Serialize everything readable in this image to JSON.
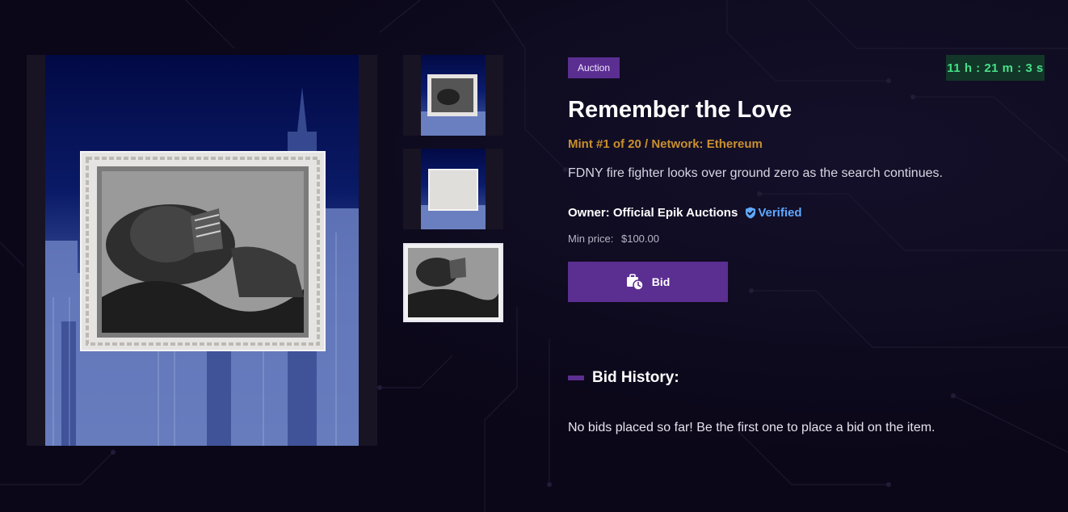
{
  "item": {
    "type_badge": "Auction",
    "countdown": "11 h : 21 m : 3 s",
    "title": "Remember the Love",
    "mint_info": "Mint #1 of 20  / Network: Ethereum",
    "description": "FDNY fire fighter looks over ground zero as the search continues.",
    "owner_label": "Owner: Official Epik Auctions",
    "verified_label": "Verified",
    "min_price_label": "Min price:",
    "min_price_value": "$100.00",
    "bid_button_label": "Bid"
  },
  "history": {
    "heading": "Bid History:",
    "empty_message": "No bids placed so far! Be the first one to place a bid on the item."
  },
  "colors": {
    "accent": "#5b2e91",
    "mint": "#c9902e",
    "timer_text": "#46e08a",
    "verified": "#5fa8ff",
    "background": "#0b0718"
  },
  "icons": {
    "verified": "shield-check-icon",
    "bid": "briefcase-clock-icon"
  }
}
